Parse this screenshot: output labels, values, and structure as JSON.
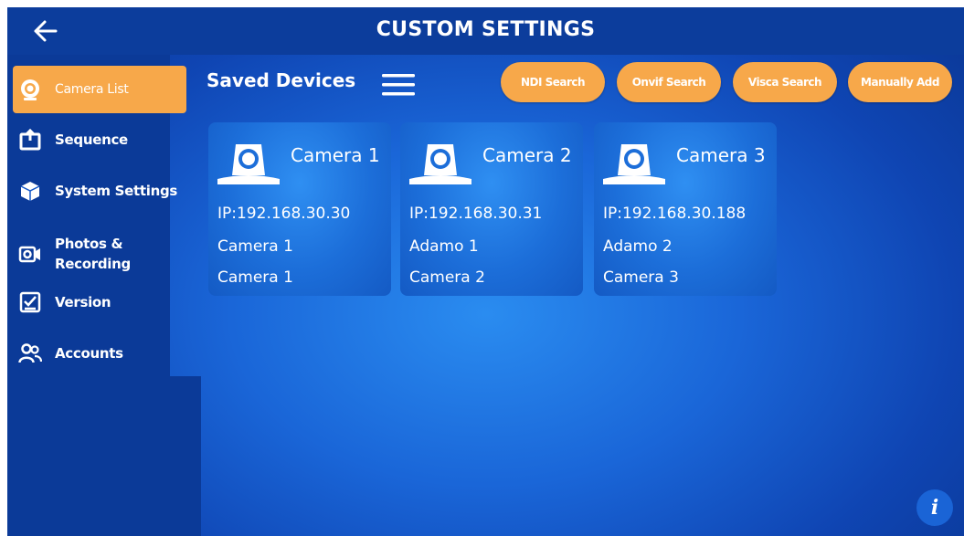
{
  "header": {
    "title": "CUSTOM SETTINGS",
    "back_icon": "back-arrow-icon"
  },
  "sidebar": {
    "items": [
      {
        "label": "Camera List",
        "icon": "camera-list-icon",
        "active": true
      },
      {
        "label": "Sequence",
        "icon": "sequence-icon",
        "active": false
      },
      {
        "label": "System Settings",
        "icon": "system-settings-icon",
        "active": false
      },
      {
        "label": "Photos & Recording",
        "label_line1": "Photos &",
        "label_line2": "Recording",
        "icon": "photos-recording-icon",
        "active": false
      },
      {
        "label": "Version",
        "icon": "version-icon",
        "active": false
      },
      {
        "label": "Accounts",
        "icon": "accounts-icon",
        "active": false
      }
    ]
  },
  "main": {
    "section_title": "Saved Devices",
    "menu_icon": "hamburger-menu-icon",
    "actions": {
      "ndi_search": "NDI Search",
      "onvif_search": "Onvif Search",
      "visca_search": "Visca Search",
      "manually_add": "Manually Add"
    },
    "devices": [
      {
        "name": "Camera 1",
        "ip": "IP:192.168.30.30",
        "line2": "Camera 1",
        "line3": "Camera 1"
      },
      {
        "name": "Camera 2",
        "ip": "IP:192.168.30.31",
        "line2": "Adamo 1",
        "line3": "Camera 2"
      },
      {
        "name": "Camera 3",
        "ip": "IP:192.168.30.188",
        "line2": "Adamo 2",
        "line3": "Camera 3"
      }
    ]
  },
  "info_button": "i",
  "colors": {
    "accent": "#f7a84a",
    "topbar": "#0c3d9c",
    "background": "#1a66d8"
  }
}
